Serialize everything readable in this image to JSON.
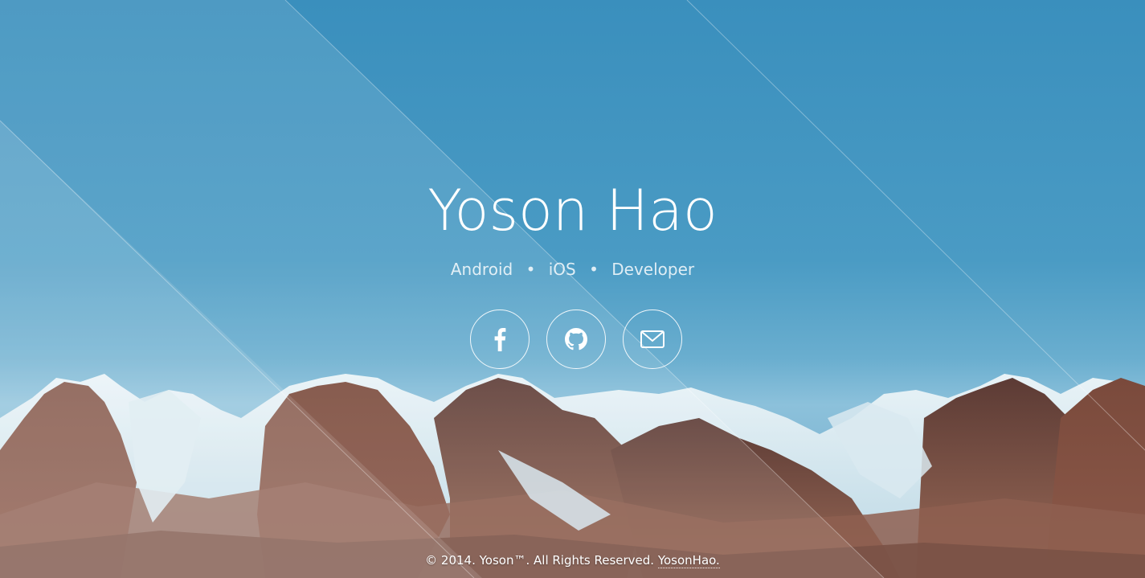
{
  "hero": {
    "name": "Yoson Hao",
    "roles": [
      "Android",
      "iOS",
      "Developer"
    ],
    "separator": "•"
  },
  "socials": [
    {
      "icon": "facebook-icon",
      "label": "f"
    },
    {
      "icon": "github-icon",
      "label": ""
    },
    {
      "icon": "mail-icon",
      "label": ""
    }
  ],
  "footer": {
    "copyright": "© 2014. Yoson™. All Rights Reserved.",
    "link_text": "YosonHao."
  },
  "colors": {
    "sky_top": "#3a8fbd",
    "sky_bottom": "#8cc1db",
    "text": "#ffffff"
  }
}
